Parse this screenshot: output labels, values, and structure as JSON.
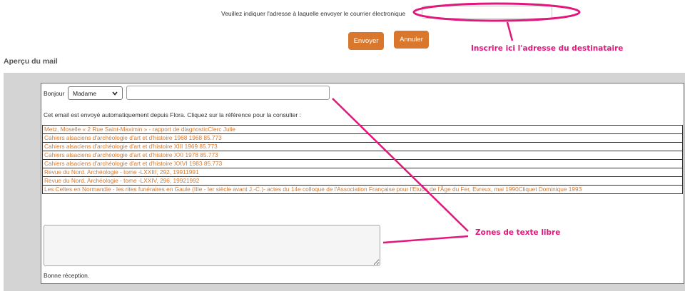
{
  "form": {
    "email_label": "Veuillez indiquer l'adresse à laquelle envoyer le courrier électronique",
    "email_value": "",
    "send_label": "Envoyer",
    "cancel_label": "Annuler"
  },
  "annotations": {
    "recipient_hint": "Inscrire ici l'adresse du destinataire",
    "free_text_hint": "Zones de texte libre",
    "accent_color": "#e0177c"
  },
  "preview": {
    "title": "Aperçu du mail",
    "greeting": "Bonjour",
    "salutation_selected": "Madame",
    "name_value": "",
    "intro": "Cet email est envoyé automatiquement depuis Flora. Cliquez sur la référence pour la consulter :",
    "references": [
      "Metz, Moselle « 2 Rue Saint-Maximin » - rapport de diagnosticClerc Julie",
      "Cahiers alsaciens d'archéologie d'art et d'histoire 1968 1968 85.773",
      "Cahiers alsaciens d'archéologie d'art et d'histoire XIII 1969 85.773",
      "Cahiers alsaciens d'archéologie d'art et d'histoire XXI 1978 85.773",
      "Cahiers alsaciens d'archéologie d'art et d'histoire XXVI 1983 85.773",
      "Revue du Nord. Archéologie - tome -LXXIII, 292, 19911991",
      "Revue du Nord. Archéologie - tome -LXXIV, 296, 19921992",
      "Les Celtes en Normandie - les rites funéraires en Gaule (IIIe - Ier siècle avant J.-C.)- actes du 14e colloque de l'Association Française pour l'Etude de l'Âge du Fer, Evreux, mai 1990Cliquet Dominique 1993"
    ],
    "free_text_value": "",
    "closing": "Bonne réception.",
    "link_color": "#d9782d"
  }
}
